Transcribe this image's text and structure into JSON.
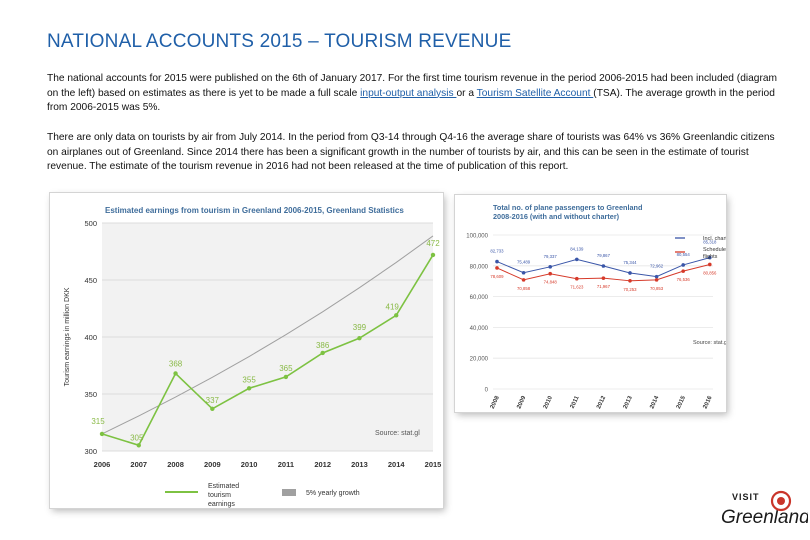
{
  "page": {
    "title": "NATIONAL ACCOUNTS 2015 – TOURISM REVENUE",
    "paragraph1": {
      "before_link1": "The national accounts for 2015 were published on the 6th of January 2017. For the first time tourism revenue in the period 2006-2015 had been included (diagram on the left) based on estimates as there is yet to be made a full scale ",
      "link1": "input-output analysis ",
      "between_links": "or a ",
      "link2": "Tourism Satellite Account ",
      "after_link2": "(TSA). The average growth in the period from 2006-2015 was 5%."
    },
    "paragraph2": "There are only data on tourists by air from July 2014. In the period from Q3-14 through Q4-16 the average share of tourists was 64% vs 36% Greenlandic citizens on airplanes out of Greenland. Since 2014 there has been a significant growth in the number of tourists by air, and this can be seen in the estimate of tourist revenue. The estimate of the tourism revenue in 2016 had not been released at the time of publication of this report."
  },
  "logo": {
    "word1": "VISIT",
    "word2": "Greenland"
  },
  "chart_data": [
    {
      "type": "line",
      "title": "Estimated earnings from tourism in Greenland 2006-2015, Greenland Statistics",
      "xlabel": "",
      "ylabel": "Tourism earnings in million DKK",
      "categories": [
        "2006",
        "2007",
        "2008",
        "2009",
        "2010",
        "2011",
        "2012",
        "2013",
        "2014",
        "2015"
      ],
      "ylim": [
        300,
        500
      ],
      "yticks": [
        "500",
        "450",
        "400",
        "350",
        "300"
      ],
      "series": [
        {
          "name": "Estimated tourism earnings",
          "values": [
            315,
            305,
            368,
            337,
            355,
            365,
            386,
            399,
            419,
            472
          ],
          "labels": [
            "315",
            "305",
            "368",
            "337",
            "355",
            "365",
            "386",
            "399",
            "419",
            "472"
          ],
          "color": "#7dc242"
        },
        {
          "name": "5% yearly growth",
          "values": [
            315,
            330.75,
            347.29,
            364.65,
            382.88,
            402.03,
            422.13,
            443.24,
            465.4,
            488.67
          ],
          "color": "#a0a0a0"
        }
      ],
      "source": "Source: stat.gl",
      "grid": true,
      "legend": "bottom"
    },
    {
      "type": "line",
      "title": "Total no. of plane passengers to Greenland 2008-2016 (with and without charter)",
      "xlabel": "",
      "ylabel": "",
      "categories": [
        "2008",
        "2009",
        "2010",
        "2011",
        "2012",
        "2013",
        "2014",
        "2015",
        "2016"
      ],
      "ylim": [
        0,
        100000
      ],
      "yticks": [
        "100,000",
        "80,000",
        "60,000",
        "40,000",
        "20,000",
        "0"
      ],
      "series": [
        {
          "name": "Incl. charter",
          "values": [
            82733,
            75489,
            79337,
            84139,
            79867,
            75344,
            72962,
            80554,
            85318
          ],
          "labels": [
            "82,733",
            "75,489",
            "79,337",
            "84,139",
            "79,867",
            "75,344",
            "72,962",
            "80,554",
            "85,318"
          ],
          "color": "#3a56a8"
        },
        {
          "name": "Scheduled flights",
          "values": [
            78609,
            70858,
            74848,
            71623,
            71967,
            70253,
            70853,
            76536,
            80856
          ],
          "labels": [
            "78,609",
            "70,858",
            "74,848",
            "71,623",
            "71,967",
            "70,253",
            "70,853",
            "76,536",
            "80,856"
          ],
          "color": "#d63a2a"
        }
      ],
      "source": "Source: stat.gl",
      "grid": true,
      "legend": "right"
    }
  ]
}
